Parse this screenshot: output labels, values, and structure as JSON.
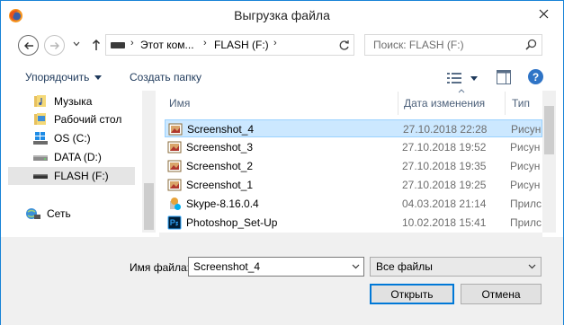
{
  "window": {
    "title": "Выгрузка файла",
    "app_icon": "firefox-icon"
  },
  "navigation": {
    "back_icon": "back-arrow-icon",
    "forward_icon": "forward-arrow-icon",
    "up_icon": "up-arrow-icon",
    "breadcrumb": [
      "Этот ком...",
      "FLASH (F:)"
    ],
    "refresh_icon": "refresh-icon"
  },
  "search": {
    "placeholder": "Поиск: FLASH (F:)"
  },
  "toolbar": {
    "organize_label": "Упорядочить",
    "new_folder_label": "Создать папку"
  },
  "sidebar": {
    "items": [
      {
        "label": "Музыка",
        "icon": "music-folder-icon"
      },
      {
        "label": "Рабочий стол",
        "icon": "desktop-folder-icon"
      },
      {
        "label": "OS (C:)",
        "icon": "windows-drive-icon"
      },
      {
        "label": "DATA (D:)",
        "icon": "drive-icon"
      },
      {
        "label": "FLASH (F:)",
        "icon": "usb-drive-icon",
        "selected": true
      },
      {
        "label": "Сеть",
        "icon": "network-icon"
      }
    ]
  },
  "file_list": {
    "columns": [
      "Имя",
      "Дата изменения",
      "Тип"
    ],
    "rows": [
      {
        "name": "Screenshot_4",
        "date": "27.10.2018 22:28",
        "type": "Рисун",
        "icon": "image-file-icon",
        "selected": true
      },
      {
        "name": "Screenshot_3",
        "date": "27.10.2018 19:52",
        "type": "Рисун",
        "icon": "image-file-icon"
      },
      {
        "name": "Screenshot_2",
        "date": "27.10.2018 19:35",
        "type": "Рисун",
        "icon": "image-file-icon"
      },
      {
        "name": "Screenshot_1",
        "date": "27.10.2018 19:25",
        "type": "Рисун",
        "icon": "image-file-icon"
      },
      {
        "name": "Skype-8.16.0.4",
        "date": "04.03.2018 21:14",
        "type": "Прилс",
        "icon": "skype-installer-icon"
      },
      {
        "name": "Photoshop_Set-Up",
        "date": "10.02.2018 15:41",
        "type": "Прилс",
        "icon": "photoshop-installer-icon"
      }
    ]
  },
  "footer": {
    "filename_label": "Имя файла:",
    "filename_value": "Screenshot_4",
    "filter_value": "Все файлы",
    "open_label": "Открыть",
    "cancel_label": "Отмена"
  }
}
